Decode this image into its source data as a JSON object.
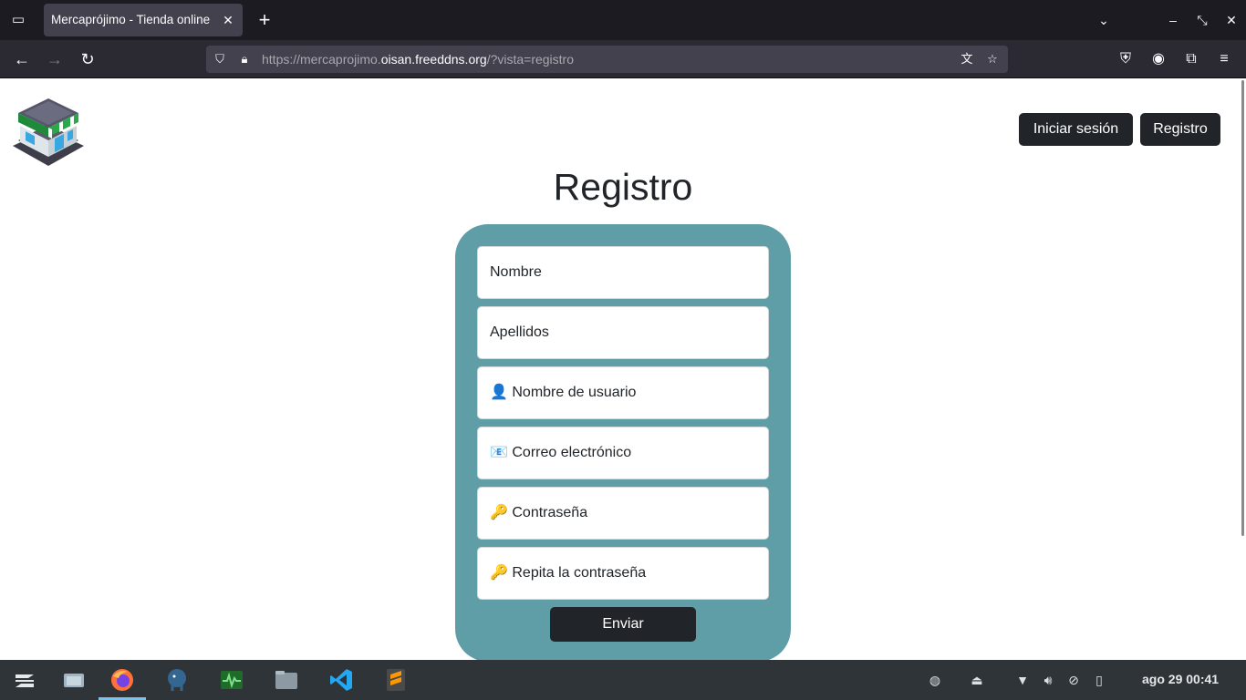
{
  "browser": {
    "tab_title": "Mercaprójimo - Tienda online",
    "url_prefix": "https://mercaprojimo.",
    "url_host": "oisan.freeddns.org",
    "url_path": "/?vista=registro"
  },
  "header": {
    "login_label": "Iniciar sesión",
    "register_label": "Registro"
  },
  "main": {
    "title": "Registro",
    "fields": [
      {
        "placeholder": "Nombre"
      },
      {
        "placeholder": "Apellidos"
      },
      {
        "placeholder": "👤 Nombre de usuario"
      },
      {
        "placeholder": "📧 Correo electrónico"
      },
      {
        "placeholder": "🔑 Contraseña"
      },
      {
        "placeholder": "🔑 Repita la contraseña"
      }
    ],
    "submit_label": "Enviar"
  },
  "taskbar": {
    "clock": "ago 29  00:41"
  },
  "colors": {
    "form_bg": "#5f9ea6",
    "button_bg": "#212529",
    "chrome_dark": "#1c1b22"
  }
}
